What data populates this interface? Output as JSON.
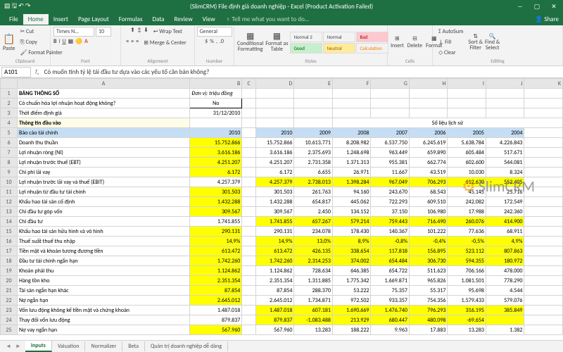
{
  "title": "(SlimCRM) File định giá doanh nghiệp - Excel (Product Activation Failed)",
  "share": "Share",
  "tellme": "Tell me what you want to do…",
  "tabs": [
    "File",
    "Home",
    "Insert",
    "Page Layout",
    "Formulas",
    "Data",
    "Review",
    "View"
  ],
  "clipboard": {
    "cut": "Cut",
    "copy": "Copy",
    "fp": "Format Painter",
    "paste": "Paste",
    "lbl": "Clipboard"
  },
  "font": {
    "name": "Times N…",
    "size": "10",
    "lbl": "Font"
  },
  "align": {
    "wrap": "Wrap Text",
    "merge": "Merge & Center",
    "lbl": "Alignment"
  },
  "number": {
    "fmt": "General",
    "lbl": "Number"
  },
  "styles": {
    "cf": "Conditional\nFormatting",
    "ft": "Format as\nTable",
    "n2": "Normal 2",
    "n": "Normal",
    "bad": "Bad",
    "good": "Good",
    "neutral": "Neutral",
    "calc": "Calculation",
    "lbl": "Styles"
  },
  "cells": {
    "i": "Insert",
    "d": "Delete",
    "f": "Format",
    "lbl": "Cells"
  },
  "edit": {
    "sum": "AutoSum",
    "fill": "Fill",
    "clr": "Clear",
    "sort": "Sort &\nFilter",
    "find": "Find &\nSelect",
    "lbl": "Editing"
  },
  "namebox": "A101",
  "formula": "Có muốn tính tỷ lệ tái đầu tư dựa vào các yếu tố căn bản không?",
  "cols": [
    "",
    "A",
    "B",
    "C",
    "D",
    "E",
    "F",
    "G",
    "H",
    "I",
    "J",
    "K"
  ],
  "hist_header": "Số liệu lịch sử",
  "rows": [
    {
      "n": 1,
      "a": "BẢNG THÔNG SỐ",
      "cls": "section-head",
      "b": "Đơn vị: triệu đồng",
      "btype": "label"
    },
    {
      "n": 2,
      "a": "Có chuẩn hóa lợi nhuận hoạt động không?",
      "b": "No",
      "btype": "boxed"
    },
    {
      "n": 3,
      "a": "Thời điểm định giá",
      "b": "31/12/2010",
      "btype": "normal"
    },
    {
      "n": 4,
      "a": "Thông tin đầu vào",
      "cls": "section-input"
    },
    {
      "n": 5,
      "a": "Báo cáo tài chính",
      "cls": "section-fin",
      "b": "2010",
      "years": [
        "2010",
        "2009",
        "2008",
        "2007",
        "2006",
        "2005",
        "2004"
      ]
    },
    {
      "n": 6,
      "a": "Doanh thu thuần",
      "b": "15.752.866",
      "hl": true,
      "d": [
        "15.752.866",
        "10.613.771",
        "8.208.982",
        "6.537.750",
        "6.245.619",
        "5.638.784",
        "4.226.843"
      ]
    },
    {
      "n": 7,
      "a": "Lợi nhuận ròng (NI)",
      "b": "3.616.186",
      "hl": true,
      "d": [
        "3.616.186",
        "2.375.693",
        "1.248.698",
        "963.449",
        "659.890",
        "605.484",
        "517.671"
      ]
    },
    {
      "n": 8,
      "a": "Lợi nhuận trước thuế (EBT)",
      "b": "4.251.207",
      "hl": true,
      "d": [
        "4.251.207",
        "2.731.358",
        "1.371.313",
        "955.381",
        "662.774",
        "602.600",
        "544.081"
      ]
    },
    {
      "n": 9,
      "a": "Chi phí lãi vay",
      "b": "6.172",
      "hl": true,
      "d": [
        "6.172",
        "6.655",
        "26.971",
        "11.667",
        "43.519",
        "10.030",
        "8.324"
      ]
    },
    {
      "n": 10,
      "a": "Lợi nhuận trước lãi vay và thuế (EBIT)",
      "b": "4.257.379",
      "d": [
        "4.257.379",
        "2.738.013",
        "1.398.284",
        "967.049",
        "706.293",
        "612.630",
        "552.405"
      ],
      "dhl": true
    },
    {
      "n": 11,
      "a": "Lợi nhuận từ đầu tư tài chính",
      "b": "301.503",
      "hl": true,
      "d": [
        "301.503",
        "261.763",
        "94.160",
        "243.670",
        "68.543",
        "45.145",
        "25.716"
      ]
    },
    {
      "n": 12,
      "a": "Khấu hao tài sản cố định",
      "b": "1.432.288",
      "hl": true,
      "d": [
        "1.432.288",
        "654.817",
        "445.062",
        "722.293",
        "609.510",
        "242.082",
        "172.549"
      ]
    },
    {
      "n": 13,
      "a": "Chi đầu tư góp vốn",
      "b": "309.567",
      "hl": true,
      "d": [
        "309.567",
        "2.450",
        "134.152",
        "37.150",
        "106.980",
        "17.988",
        "242.360"
      ]
    },
    {
      "n": 14,
      "a": "Chi đầu tư",
      "b": "1.741.855",
      "d": [
        "1.741.855",
        "657.267",
        "579.214",
        "759.443",
        "716.490",
        "260.076",
        "414.900"
      ],
      "dhl": true
    },
    {
      "n": 15,
      "a": "Khấu hao tài sản hữu hình và vô hình",
      "b": "290.131",
      "hl": true,
      "d": [
        "290.131",
        "234.078",
        "178.430",
        "140.367",
        "101.222",
        "77.636",
        "68.911"
      ]
    },
    {
      "n": 16,
      "a": "Thuế suất thuế thu nhập",
      "b": "14,9%",
      "hl": true,
      "d": [
        "14,9%",
        "13,0%",
        "8,9%",
        "-0,8%",
        "-0,4%",
        "-0,5%",
        "4,9%"
      ],
      "dhl": true
    },
    {
      "n": 17,
      "a": "Tiền mặt và khoản tương đương tiền",
      "b": "613.472",
      "hl": true,
      "d": [
        "613.472",
        "426.135",
        "338.654",
        "117.818",
        "156.895",
        "523.112",
        "807.863"
      ],
      "dhl": true
    },
    {
      "n": 18,
      "a": "Đầu tư tài chính ngắn hạn",
      "b": "1.742.260",
      "hl": true,
      "d": [
        "1.742.260",
        "2.314.253",
        "374.002",
        "654.484",
        "306.730",
        "594.355",
        "180.972"
      ],
      "dhl": true
    },
    {
      "n": 19,
      "a": "Khoản phải thu",
      "b": "1.124.862",
      "hl": true,
      "d": [
        "1.124.862",
        "728.634",
        "646.385",
        "654.722",
        "511.623",
        "706.166",
        "478.000"
      ]
    },
    {
      "n": 20,
      "a": "Hàng tồn kho",
      "b": "2.351.354",
      "hl": true,
      "d": [
        "2.351.354",
        "1.311.885",
        "1.775.342",
        "1.669.871",
        "965.826",
        "1.081.501",
        "778.290"
      ]
    },
    {
      "n": 21,
      "a": "Tài sản ngắn hạn khác",
      "b": "87.854",
      "hl": true,
      "d": [
        "87.854",
        "288.370",
        "53.222",
        "75.357",
        "55.317",
        "95.698",
        "4.544"
      ]
    },
    {
      "n": 22,
      "a": "Nợ ngắn hạn",
      "b": "2.645.012",
      "hl": true,
      "d": [
        "2.645.012",
        "1.734.871",
        "972.502",
        "933.357",
        "754.356",
        "1.579.433",
        "579.076"
      ]
    },
    {
      "n": 23,
      "a": "Vốn lưu động không kể tiền mặt và chứng khoán",
      "b": "1.487.018",
      "d": [
        "1.487.018",
        "607.181",
        "1.690.669",
        "1.476.740",
        "796.293",
        "316.195",
        "385.849"
      ],
      "dhl": true
    },
    {
      "n": 24,
      "a": "Thay đổi vốn lưu động",
      "b": "879.837",
      "d": [
        "879.837",
        "-1.083.488",
        "213.929",
        "680.447",
        "480.098",
        "-69.654",
        ""
      ],
      "dhl": true
    },
    {
      "n": 25,
      "a": "Nợ vay ngắn hạn",
      "b": "567.960",
      "hl": true,
      "d": [
        "567.960",
        "13.283",
        "188.222",
        "9.963",
        "17.883",
        "13.283",
        "1.382"
      ]
    }
  ],
  "sheets": [
    "Inputs",
    "Valuation",
    "Normalizer",
    "Beta",
    "Quản trị doanh nghiệp dễ dàng"
  ],
  "watermark": "SlimCRM"
}
